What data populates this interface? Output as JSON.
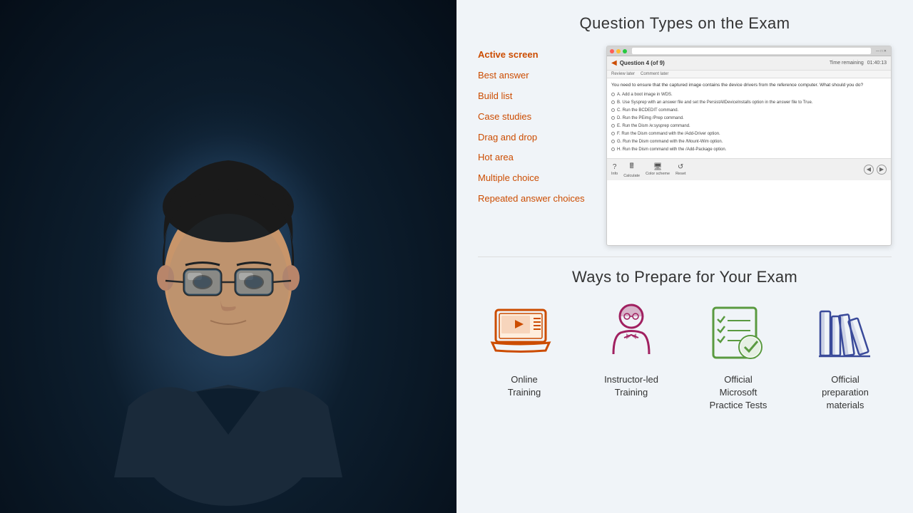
{
  "left": {
    "alt": "Person studying at computer"
  },
  "right": {
    "top": {
      "title": "Question Types on the Exam",
      "questions": [
        {
          "label": "Active screen",
          "active": true
        },
        {
          "label": "Best answer",
          "active": false
        },
        {
          "label": "Build list",
          "active": false
        },
        {
          "label": "Case studies",
          "active": false
        },
        {
          "label": "Drag and drop",
          "active": false
        },
        {
          "label": "Hot area",
          "active": false
        },
        {
          "label": "Multiple choice",
          "active": false
        },
        {
          "label": "Repeated answer choices",
          "active": false
        }
      ],
      "mockup": {
        "question_title": "Question 4 (of 9)",
        "time_label": "Time remaining",
        "time_value": "01:40:13",
        "nav_items": [
          "Review later",
          "Comment later"
        ],
        "question_text": "You need to ensure that the captured image contains the device drivers from the reference computer. What should you do?",
        "answers": [
          "A. Add a boot image in WDS.",
          "B. Use Sysprep with an answer file and set the PersistAllDeviceInstalls option in the answer file to True.",
          "C. Run the BCDEDIT command.",
          "D. Run the PEimg /Prep command.",
          "E. Run the Dism /e:sysprep command.",
          "F. Run the Dism command with the /Add-Driver option.",
          "G. Run the Dism command with the /Mount-Wim option.",
          "H. Run the Dism command with the /Add-Package option."
        ],
        "footer_icons": [
          "Info",
          "Calculate",
          "Color scheme",
          "Reset"
        ],
        "nav_prev": "◀",
        "nav_next": "▶"
      }
    },
    "bottom": {
      "title": "Ways to Prepare for Your Exam",
      "items": [
        {
          "icon": "laptop",
          "label": "Online\nTraining",
          "color": "#cc4c00"
        },
        {
          "icon": "instructor",
          "label": "Instructor-led\nTraining",
          "color": "#a02060"
        },
        {
          "icon": "checklist",
          "label": "Official\nMicrosoft\nPractice Tests",
          "color": "#5a9a40"
        },
        {
          "icon": "books",
          "label": "Official\npreparation\nmaterials",
          "color": "#3a4a9a"
        }
      ]
    }
  }
}
